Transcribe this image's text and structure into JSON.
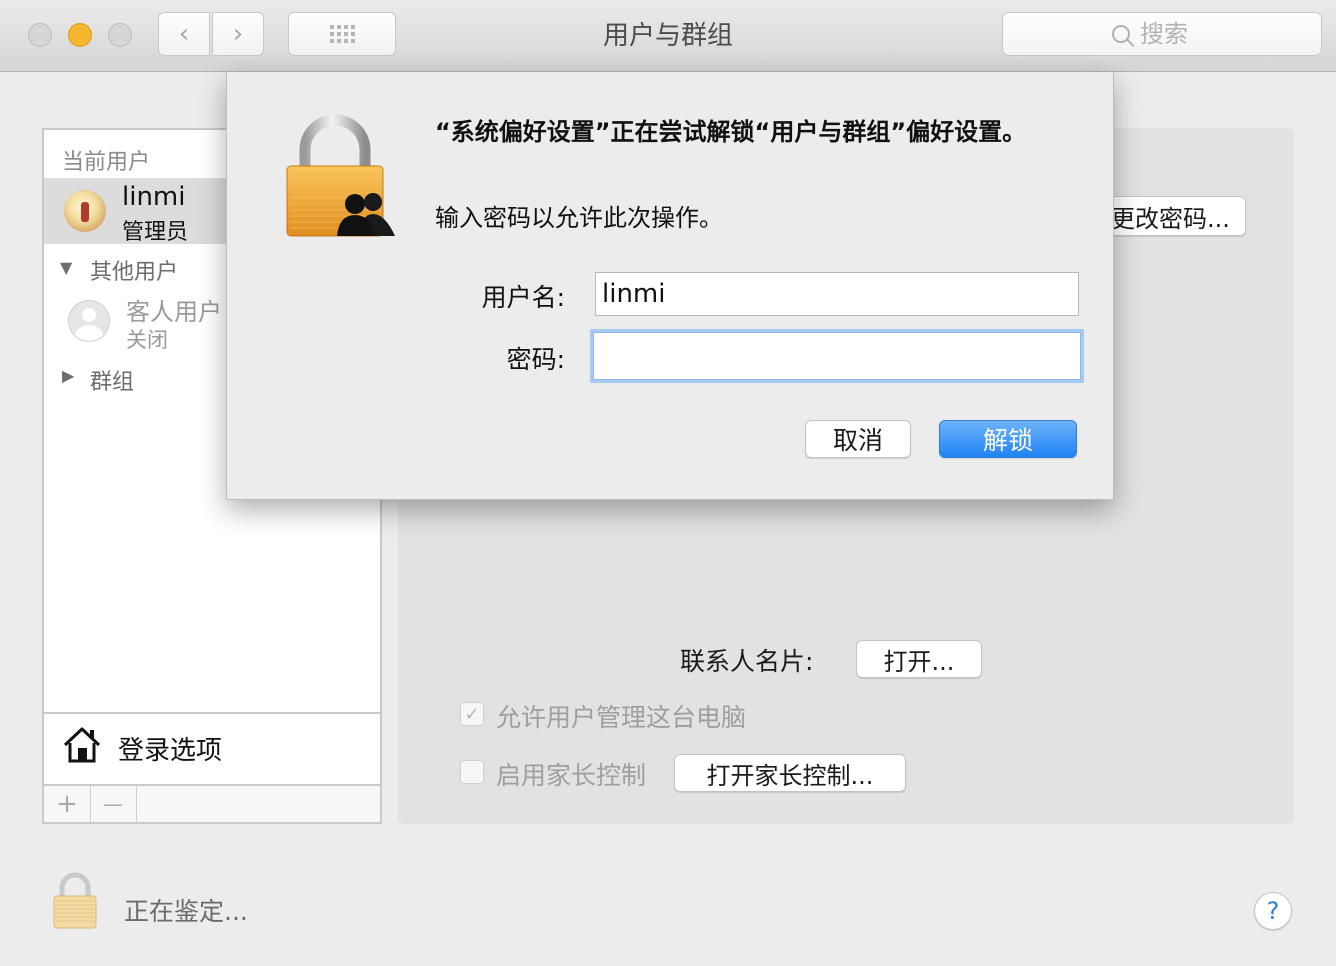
{
  "window": {
    "title": "用户与群组",
    "search_placeholder": "搜索"
  },
  "sidebar": {
    "current_header": "当前用户",
    "current_user": {
      "name": "linmi",
      "role": "管理员"
    },
    "other_header": "其他用户",
    "guest": {
      "name": "客人用户",
      "status": "关闭"
    },
    "groups_header": "群组",
    "login_options": "登录选项",
    "add_label": "+",
    "remove_label": "—"
  },
  "pane": {
    "change_password": "更改密码...",
    "contact_card_label": "联系人名片:",
    "open_button": "打开...",
    "allow_admin": {
      "label": "允许用户管理这台电脑",
      "checked": true
    },
    "parental": {
      "label": "启用家长控制",
      "checked": false
    },
    "parental_button": "打开家长控制..."
  },
  "footer": {
    "auth_status": "正在鉴定...",
    "help": "?"
  },
  "dialog": {
    "title": "“系统偏好设置”正在尝试解锁“用户与群组”偏好设置。",
    "info": "输入密码以允许此次操作。",
    "username_label": "用户名:",
    "username_value": "linmi",
    "password_label": "密码:",
    "password_value": "",
    "cancel": "取消",
    "unlock": "解锁"
  },
  "colors": {
    "accent": "#1f83f4",
    "window_bg": "#ececec",
    "lock_gold": "#f0a63a"
  }
}
